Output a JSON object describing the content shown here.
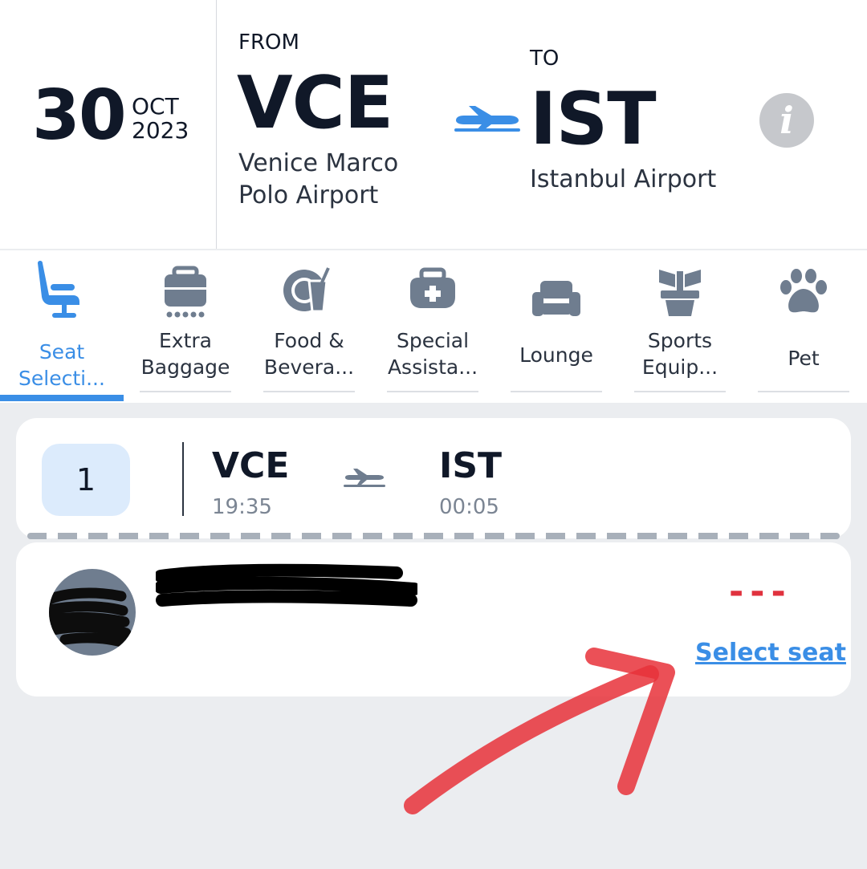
{
  "header": {
    "date": {
      "day": "30",
      "month": "OCT",
      "year": "2023"
    },
    "from": {
      "label": "FROM",
      "code": "VCE",
      "airport": "Venice Marco Polo Airport"
    },
    "to": {
      "label": "TO",
      "code": "IST",
      "airport": "Istanbul Airport"
    },
    "info_icon": "info-icon",
    "plane_color": "#3a8ee6"
  },
  "tabs": [
    {
      "label": "Seat\nSelecti...",
      "icon": "seat-icon",
      "active": true
    },
    {
      "label": "Extra\nBaggage",
      "icon": "baggage-icon",
      "active": false
    },
    {
      "label": "Food &\nBevera...",
      "icon": "food-icon",
      "active": false
    },
    {
      "label": "Special\nAssista...",
      "icon": "medical-kit-icon",
      "active": false
    },
    {
      "label": "Lounge",
      "icon": "armchair-icon",
      "active": false
    },
    {
      "label": "Sports\nEquip...",
      "icon": "golf-bag-icon",
      "active": false
    },
    {
      "label": "Pet",
      "icon": "paw-icon",
      "active": false
    }
  ],
  "segment": {
    "number": "1",
    "from_code": "VCE",
    "from_time": "19:35",
    "to_code": "IST",
    "to_time": "00:05"
  },
  "passenger": {
    "seat": "---",
    "select_label": "Select seat"
  },
  "colors": {
    "accent": "#3a8ee6",
    "seat_unassigned": "#e0323e",
    "annotation_arrow": "#e8313a"
  }
}
